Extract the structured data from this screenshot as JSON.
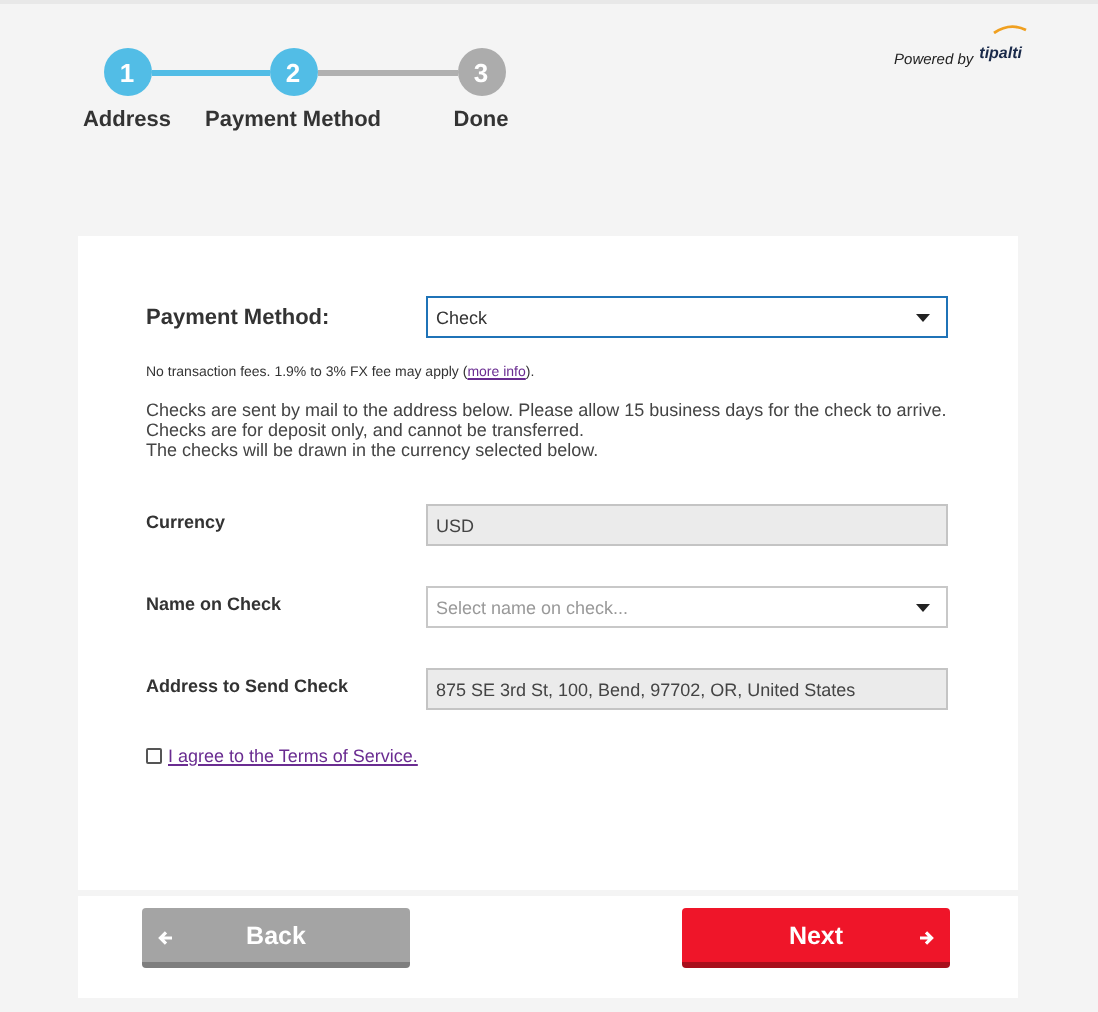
{
  "steps": [
    {
      "number": "1",
      "label": "Address",
      "active": true
    },
    {
      "number": "2",
      "label": "Payment Method",
      "active": true
    },
    {
      "number": "3",
      "label": "Done",
      "active": false
    }
  ],
  "powered_by": {
    "text": "Powered by",
    "brand": "tipalti"
  },
  "payment_method": {
    "label": "Payment Method:",
    "value": "Check"
  },
  "fee_note": {
    "before": "No transaction fees. 1.9% to 3% FX fee may apply (",
    "link": "more info",
    "after": ")."
  },
  "info_lines": [
    "Checks are sent by mail to the address below. Please allow 15 business days for the check to arrive.",
    "Checks are for deposit only, and cannot be transferred.",
    "The checks will be drawn in the currency selected below."
  ],
  "fields": [
    {
      "kind": "readonly",
      "label": "Currency",
      "value": "USD"
    },
    {
      "kind": "select",
      "label": "Name on Check",
      "placeholder": "Select name on check..."
    },
    {
      "kind": "readonly",
      "label": "Address to Send Check",
      "value": "875 SE 3rd St, 100, Bend, 97702, OR, United States"
    }
  ],
  "terms": {
    "label": "I agree to the Terms of Service.",
    "checked": false
  },
  "buttons": [
    {
      "kind": "back",
      "label": "Back"
    },
    {
      "kind": "next",
      "label": "Next"
    }
  ]
}
